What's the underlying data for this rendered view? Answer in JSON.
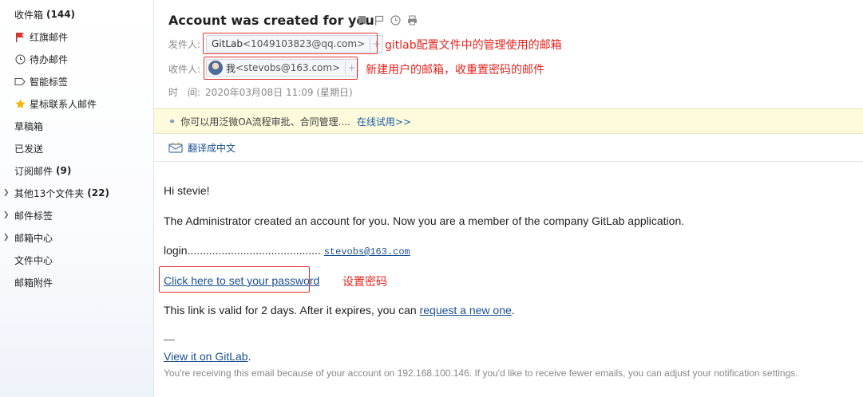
{
  "sidebar": {
    "items": [
      {
        "label": "收件箱",
        "count": "(144)"
      },
      {
        "label": "红旗邮件"
      },
      {
        "label": "待办邮件"
      },
      {
        "label": "智能标签"
      },
      {
        "label": "星标联系人邮件"
      },
      {
        "label": "草稿箱"
      },
      {
        "label": "已发送"
      },
      {
        "label": "订阅邮件",
        "count": "(9)"
      },
      {
        "label": "其他13个文件夹",
        "count": "(22)"
      },
      {
        "label": "邮件标签"
      },
      {
        "label": "邮箱中心"
      },
      {
        "label": "文件中心"
      },
      {
        "label": "邮箱附件"
      }
    ]
  },
  "email": {
    "subject": "Account was created for you",
    "from_label": "发件人:",
    "from_name": "GitLab",
    "from_addr": "<1049103823@qq.com>",
    "to_label": "收件人:",
    "to_name": "我",
    "to_addr": "<stevobs@163.com>",
    "time_label": "时　间:",
    "time_value": "2020年03月08日 11:09 (星期日)"
  },
  "annotations": {
    "from_note": "gitlab配置文件中的管理使用的邮箱",
    "to_note": "新建用户的邮箱，收重置密码的邮件",
    "link_note": "设置密码"
  },
  "banners": {
    "ad_text": "你可以用泛微OA流程审批、合同管理....",
    "ad_link": "在线试用>>",
    "translate": "翻译成中文"
  },
  "body": {
    "greeting": "Hi stevie!",
    "created": "The Administrator created an account for you. Now you are a member of the company GitLab application.",
    "login_label": "login...........................................",
    "login_value": "stevobs@163.com",
    "set_password_link": "Click here to set your password",
    "valid_prefix": "This link is valid for 2 days. After it expires, you can ",
    "valid_link": "request a new one",
    "valid_suffix": ".",
    "dash": "—",
    "view_link": "View it on GitLab",
    "view_suffix": ".",
    "footer": "You're receiving this email because of your account on 192.168.100.146. If you'd like to receive fewer emails, you can adjust your notification settings."
  },
  "colors": {
    "accent": "#1a4f8f",
    "annotation": "#e3241e",
    "banner_bg": "#fdfbdc"
  }
}
